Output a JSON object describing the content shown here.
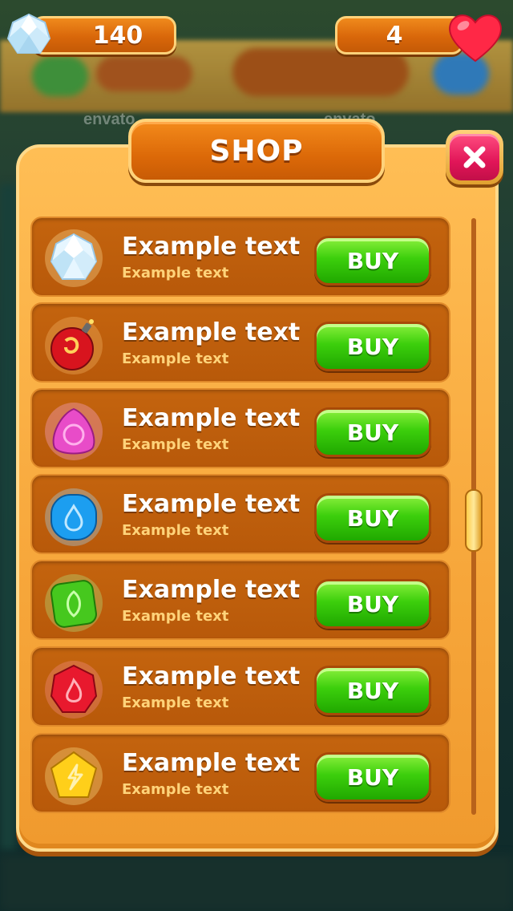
{
  "hud": {
    "gems": "140",
    "lives": "4"
  },
  "shop": {
    "title": "SHOP"
  },
  "items": [
    {
      "title": "Example text",
      "subtitle": "Example text",
      "buy_label": "BUY",
      "icon": "diamond-icon"
    },
    {
      "title": "Example text",
      "subtitle": "Example text",
      "buy_label": "BUY",
      "icon": "bomb-icon"
    },
    {
      "title": "Example text",
      "subtitle": "Example text",
      "buy_label": "BUY",
      "icon": "pink-gem-icon"
    },
    {
      "title": "Example text",
      "subtitle": "Example text",
      "buy_label": "BUY",
      "icon": "water-gem-icon"
    },
    {
      "title": "Example text",
      "subtitle": "Example text",
      "buy_label": "BUY",
      "icon": "leaf-gem-icon"
    },
    {
      "title": "Example text",
      "subtitle": "Example text",
      "buy_label": "BUY",
      "icon": "fire-gem-icon"
    },
    {
      "title": "Example text",
      "subtitle": "Example text",
      "buy_label": "BUY",
      "icon": "lightning-gem-icon"
    }
  ],
  "watermark": "envato",
  "colors": {
    "panel": "#f7a73b",
    "row": "#b8590a",
    "buy": "#3ccf0c",
    "close": "#e11558",
    "hud": "#d9670a"
  }
}
